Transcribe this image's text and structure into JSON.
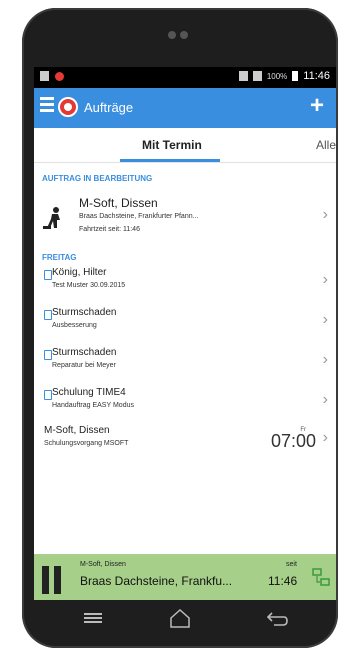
{
  "status_bar": {
    "battery_percent": "100%",
    "time": "11:46"
  },
  "app_bar": {
    "title": "Aufträge",
    "add_label": "+"
  },
  "tabs": [
    {
      "label": "Mit Termin"
    },
    {
      "label": "Alle"
    }
  ],
  "section_active": {
    "header": "AUFTRAG IN BEARBEITUNG",
    "item": {
      "title": "M-Soft, Dissen",
      "subtitle": "Braas Dachsteine, Frankfurter Pfann...",
      "time_info": "Fahrtzeit seit: 11:46",
      "icon": "worker-icon"
    }
  },
  "section_day": {
    "header": "FREITAG",
    "items": [
      {
        "title": "König, Hilter",
        "subtitle": "Test Muster 30.09.2015"
      },
      {
        "title": "Sturmschaden",
        "subtitle": "Ausbesserung"
      },
      {
        "title": "Sturmschaden",
        "subtitle": "Reparatur bei Meyer"
      },
      {
        "title": "Schulung TIME4",
        "subtitle": "Handauftrag EASY Modus"
      },
      {
        "title": "M-Soft, Dissen",
        "subtitle": "Schulungsvorgang MSOFT",
        "day": "Fr",
        "time": "07:00"
      }
    ]
  },
  "bottom_bar": {
    "customer": "M-Soft, Dissen",
    "order": "Braas Dachsteine, Frankfu...",
    "since_label": "seit",
    "since_time": "11:46"
  },
  "colors": {
    "primary": "#3a8ee0",
    "accent_red": "#e53935",
    "bottom_bar": "#a6cf8a"
  },
  "nav": {
    "icons": [
      "menu-icon",
      "home-icon",
      "back-icon"
    ]
  }
}
